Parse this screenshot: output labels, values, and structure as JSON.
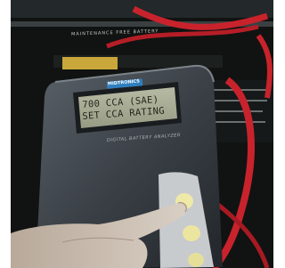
{
  "photo": {
    "lcd": {
      "line1": "700 CCA (SAE)",
      "line2": "SET CCA RATING"
    },
    "tester": {
      "brand": "MIDTRONICS",
      "model_caption": "DIGITAL BATTERY ANALYZER"
    },
    "battery_label": "MAINTENANCE FREE BATTERY",
    "colors": {
      "tester_body": "#3b4147",
      "lcd_background": "#a9ad95",
      "clamp_cable": "#c8232c",
      "keypad_button": "#e8e2a0"
    }
  }
}
